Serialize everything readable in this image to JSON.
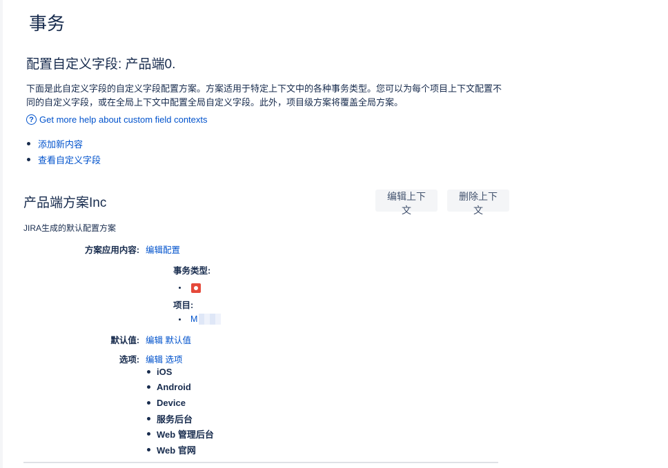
{
  "page": {
    "title": "事务"
  },
  "config": {
    "title": "配置自定义字段: 产品端0.",
    "description": "下面是此自定义字段的自定义字段配置方案。方案适用于特定上下文中的各种事务类型。您可以为每个项目上下文配置不同的自定义字段，或在全局上下文中配置全局自定义字段。此外，项目级方案将覆盖全局方案。",
    "help_link": "Get more help about custom field contexts",
    "links": [
      "添加新内容",
      "查看自定义字段"
    ]
  },
  "scheme": {
    "title": "产品端方案Inc",
    "edit_context_button": "编辑上下文",
    "delete_context_button": "删除上下文",
    "description": "JIRA生成的默认配置方案",
    "applies_label": "方案应用内容:",
    "edit_config_link": "编辑配置",
    "issue_types_label": "事务类型:",
    "projects_label": "项目:",
    "project_name": "M",
    "default_value_label": "默认值:",
    "edit_default_link": "编辑 默认值",
    "options_label": "选项:",
    "edit_options_link": "编辑 选项",
    "options": [
      "iOS",
      "Android",
      "Device",
      "服务后台",
      "Web 管理后台",
      "Web 官网"
    ]
  },
  "colors": {
    "link": "#0052cc",
    "text": "#172b4d",
    "button_bg": "#f4f5f7",
    "issue_icon": "#e5493a"
  },
  "icons": {
    "help": "help-icon",
    "issue_type": "bug-issue-type-icon"
  }
}
